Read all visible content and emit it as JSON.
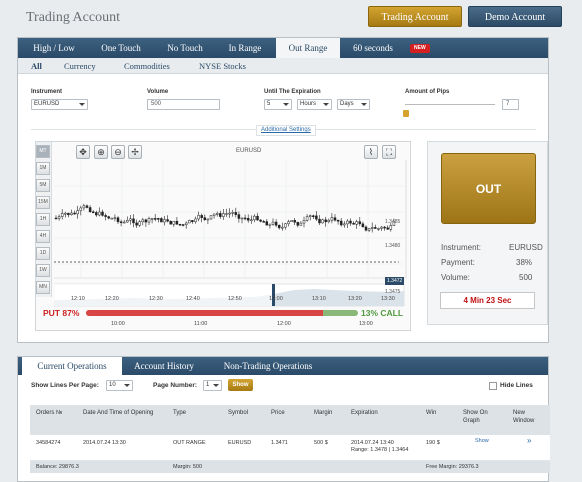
{
  "header": {
    "title": "Trading Account",
    "trading_btn": "Trading Account",
    "demo_btn": "Demo Account"
  },
  "tabs": [
    "High / Low",
    "One Touch",
    "No Touch",
    "In Range",
    "Out Range",
    "60 seconds"
  ],
  "tab_badge": "NEW",
  "subtabs": [
    "All",
    "Currency",
    "Commodities",
    "NYSE Stocks"
  ],
  "form": {
    "instrument_label": "Instrument",
    "instrument_value": "EURUSD",
    "volume_label": "Volume",
    "volume_value": "500",
    "expiration_label": "Until The Expiration",
    "exp_num": "5",
    "exp_unit1": "Hours",
    "exp_unit2": "Days",
    "pips_label": "Amount of Pips",
    "pips_value": "7",
    "settings_link": "Additional Settings"
  },
  "chart": {
    "symbol": "EURUSD",
    "prices": [
      "1.3485",
      "1.3480",
      "1.3475"
    ],
    "current_price": "1.3472",
    "times": [
      "12:10",
      "12:20",
      "12:30",
      "12:40",
      "12:50",
      "13:00",
      "13:10",
      "13:20",
      "13:30"
    ],
    "nav_times": [
      "10:00",
      "11:00",
      "12:00",
      "13:00"
    ],
    "timeframes": [
      "MT",
      "1M",
      "5M",
      "15M",
      "1H",
      "4H",
      "1D",
      "1W",
      "MN"
    ],
    "put_label": "PUT 87%",
    "call_label": "13% CALL",
    "put_pct": 87
  },
  "side": {
    "out_label": "OUT",
    "instrument_label": "Instrument:",
    "instrument_value": "EURUSD",
    "payment_label": "Payment:",
    "payment_value": "38%",
    "volume_label": "Volume:",
    "volume_value": "500",
    "timer": "4 Min 23 Sec"
  },
  "ops": {
    "tabs": [
      "Current Operations",
      "Account History",
      "Non-Trading Operations"
    ],
    "lines_label": "Show Lines Per Page:",
    "lines_value": "10",
    "page_label": "Page Number:",
    "page_value": "1",
    "show_btn": "Show",
    "hide_lines": "Hide Lines",
    "columns": [
      "Orders №",
      "Date And Time of Opening",
      "Type",
      "Symbol",
      "Price",
      "Margin",
      "Expiration",
      "Win",
      "Show On Graph",
      "New Window"
    ],
    "row": {
      "order": "34584274",
      "date": "2014.07.24 13:30",
      "type": "OUT RANGE",
      "symbol": "EURUSD",
      "price": "1.3471",
      "margin": "500 $",
      "expiration": "2014.07.24 13:40",
      "range": "Range: 1.3478 | 1.3464",
      "win": "190 $",
      "show": "Show",
      "new_window": "»"
    },
    "balance": "Balance: 29876.3",
    "margin_total": "Margin: 500",
    "free_margin": "Free Margin: 29376.3"
  }
}
